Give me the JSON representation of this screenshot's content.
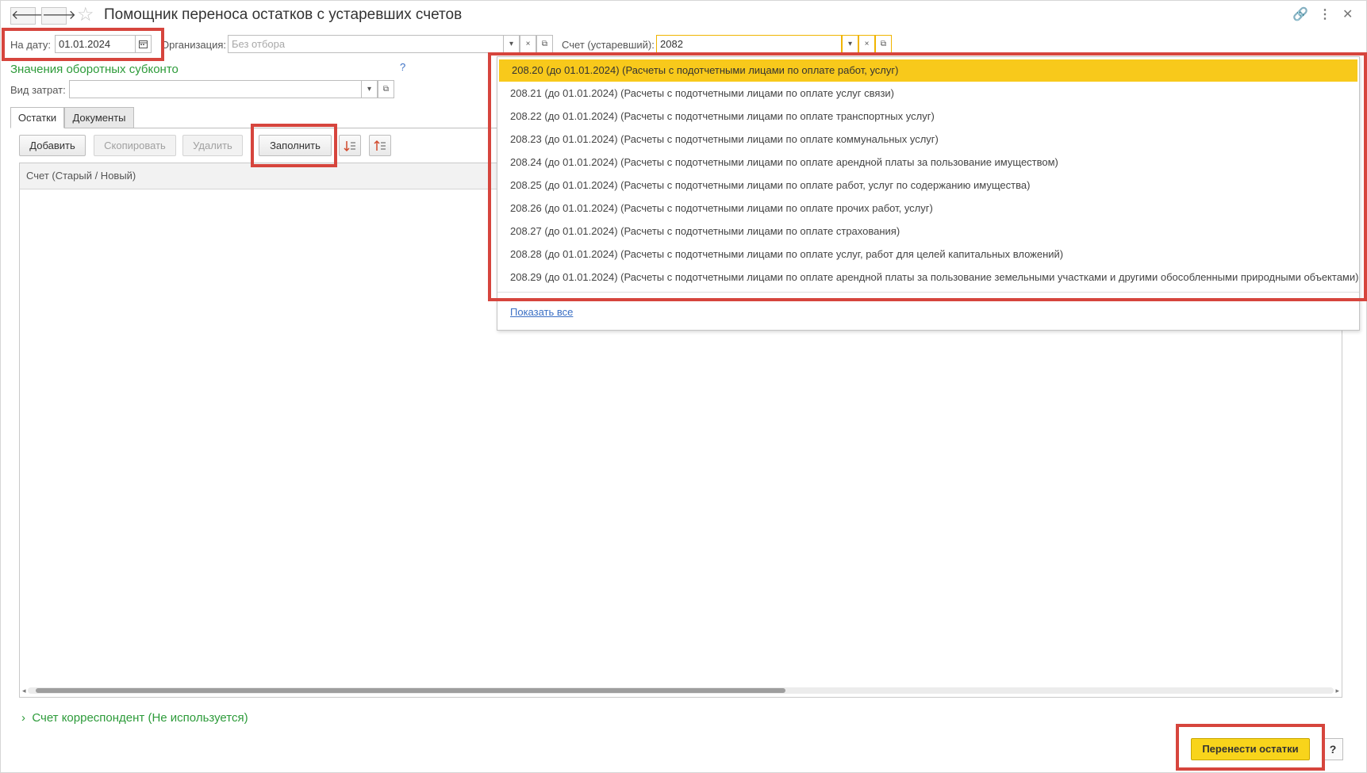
{
  "window": {
    "title": "Помощник переноса остатков с устаревших счетов",
    "back_icon": "🡐",
    "forward_icon": "🡒",
    "star_icon": "☆",
    "link_icon": "🔗",
    "menu_icon": "⋮",
    "close_icon": "✕"
  },
  "filters": {
    "date_label": "На дату:",
    "date_value": "01.01.2024",
    "org_label": "Организация:",
    "org_placeholder": "Без отбора",
    "account_label": "Счет (устаревший):",
    "account_value": "2082"
  },
  "subconto": {
    "title": "Значения оборотных субконто",
    "help": "?",
    "cost_type_label": "Вид затрат:",
    "cost_type_value": ""
  },
  "tabs": [
    {
      "label": "Остатки"
    },
    {
      "label": "Документы"
    }
  ],
  "toolbar": {
    "add": "Добавить",
    "copy": "Скопировать",
    "delete": "Удалить",
    "fill": "Заполнить"
  },
  "table": {
    "column_header": "Счет (Старый / Новый)"
  },
  "dropdown": {
    "items": [
      "208.20 (до 01.01.2024) (Расчеты с подотчетными лицами по оплате работ, услуг)",
      "208.21 (до 01.01.2024) (Расчеты с подотчетными лицами по оплате услуг связи)",
      "208.22 (до 01.01.2024) (Расчеты с подотчетными лицами по оплате транспортных услуг)",
      "208.23 (до 01.01.2024) (Расчеты с подотчетными лицами по оплате коммунальных услуг)",
      "208.24 (до 01.01.2024) (Расчеты с подотчетными лицами по оплате арендной платы за пользование имуществом)",
      "208.25 (до 01.01.2024) (Расчеты с подотчетными лицами по оплате работ, услуг по содержанию имущества)",
      "208.26 (до 01.01.2024) (Расчеты с подотчетными лицами по оплате прочих работ, услуг)",
      "208.27 (до 01.01.2024) (Расчеты с подотчетными лицами по оплате страхования)",
      "208.28 (до 01.01.2024) (Расчеты с подотчетными лицами по оплате услуг, работ для целей капитальных вложений)",
      "208.29 (до 01.01.2024) (Расчеты с подотчетными лицами по оплате арендной платы за пользование земельными участками и другими обособленными природными объектами)"
    ],
    "show_all": "Показать все"
  },
  "footer": {
    "correspondent": "Счет корреспондент (Не используется)",
    "transfer_button": "Перенести остатки",
    "help": "?"
  }
}
